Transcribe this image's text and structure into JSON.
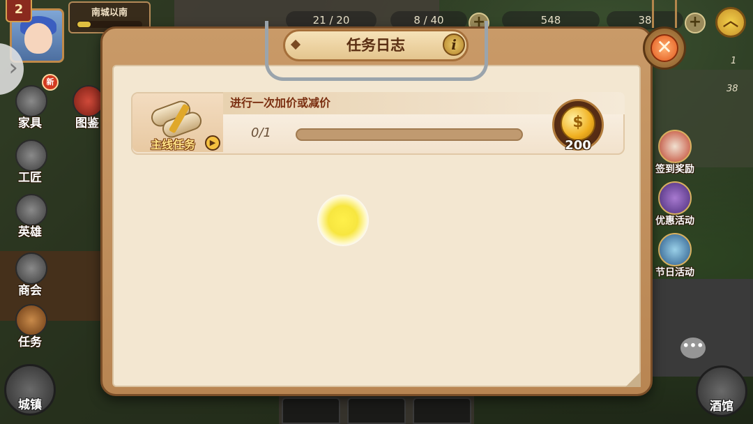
{
  "hud": {
    "player_level": "2",
    "town_name": "南城以南",
    "town_progress": 0.2,
    "resources": [
      {
        "icon": "furniture-resource-icon",
        "value": "21 / 20"
      },
      {
        "icon": "worker-resource-icon",
        "value": "8 / 40"
      },
      {
        "icon": "gold-coin-icon",
        "value": "548"
      },
      {
        "icon": "gem-icon",
        "value": "38"
      }
    ]
  },
  "left_menu": {
    "new_badge": "新",
    "items": [
      {
        "id": "furniture",
        "label": "家具",
        "icon": "furniture-icon"
      },
      {
        "id": "catalog",
        "label": "图鉴",
        "icon": "catalog-book-icon"
      },
      {
        "id": "craftsman",
        "label": "工匠",
        "icon": "craftsman-icon"
      },
      {
        "id": "hero",
        "label": "英雄",
        "icon": "hero-helmet-icon"
      },
      {
        "id": "guild",
        "label": "商会",
        "icon": "gear-icon"
      },
      {
        "id": "quest",
        "label": "任务",
        "icon": "quest-book-icon"
      }
    ],
    "town_button": "城镇"
  },
  "right_menu": {
    "side_numbers": [
      "1",
      "38"
    ],
    "items": [
      {
        "id": "signin",
        "label": "签到奖励",
        "icon": "signin-reward-icon"
      },
      {
        "id": "offers",
        "label": "优惠活动",
        "icon": "offer-chest-icon"
      },
      {
        "id": "festival",
        "label": "节日活动",
        "icon": "festival-icon"
      }
    ],
    "chat_icon": "•••",
    "tavern_button": "酒馆"
  },
  "dialog": {
    "title": "任务日志",
    "info_label": "i",
    "close_label": "✕",
    "quests": [
      {
        "type_label": "主线任务",
        "title": "进行一次加价或减价",
        "progress_text": "0/1",
        "progress": 0,
        "reward_icon": "gold-coin-icon",
        "reward_amount": "200"
      }
    ]
  },
  "colors": {
    "dialog_frame": "#b88552",
    "dialog_paper": "#f3e7d1",
    "quest_title": "#7a2e10",
    "close_button": "#e2571c",
    "progress_fill": "#f0c040"
  }
}
